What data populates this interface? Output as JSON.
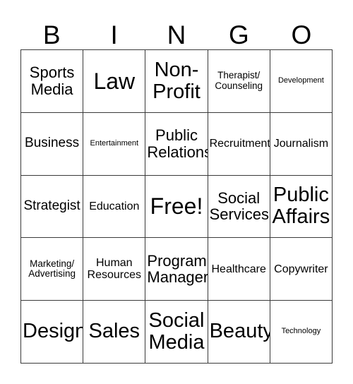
{
  "card": {
    "title": "BINGO",
    "header_letters": [
      "B",
      "I",
      "N",
      "G",
      "O"
    ],
    "free_space_label": "Free!",
    "colors": {
      "background": "#ffffff",
      "border": "#3a3a3a",
      "text": "#000000"
    },
    "grid": {
      "columns": 5,
      "rows": 5
    },
    "cells": [
      {
        "text": "Sports\nMedia",
        "size": "l",
        "free": false
      },
      {
        "text": "Law",
        "size": "huge",
        "free": false
      },
      {
        "text": "Non-\nProfit",
        "size": "xxl",
        "free": false
      },
      {
        "text": "Therapist/\nCounseling",
        "size": "xs",
        "free": false
      },
      {
        "text": "Development",
        "size": "xxs",
        "free": false
      },
      {
        "text": "Business",
        "size": "m",
        "free": false
      },
      {
        "text": "Entertainment",
        "size": "xxs",
        "free": false
      },
      {
        "text": "Public\nRelations",
        "size": "l",
        "free": false
      },
      {
        "text": "Recruitment",
        "size": "s",
        "free": false
      },
      {
        "text": "Journalism",
        "size": "s",
        "free": false
      },
      {
        "text": "Strategist",
        "size": "m",
        "free": false
      },
      {
        "text": "Education",
        "size": "s",
        "free": false
      },
      {
        "text": "Free!",
        "size": "huge",
        "free": true
      },
      {
        "text": "Social\nServices",
        "size": "l",
        "free": false
      },
      {
        "text": "Public\nAffairs",
        "size": "xxl",
        "free": false
      },
      {
        "text": "Marketing/\nAdvertising",
        "size": "xs",
        "free": false
      },
      {
        "text": "Human\nResources",
        "size": "s",
        "free": false
      },
      {
        "text": "Program\nManager",
        "size": "l",
        "free": false
      },
      {
        "text": "Healthcare",
        "size": "s",
        "free": false
      },
      {
        "text": "Copywriter",
        "size": "s",
        "free": false
      },
      {
        "text": "Design",
        "size": "xxl",
        "free": false
      },
      {
        "text": "Sales",
        "size": "xxl",
        "free": false
      },
      {
        "text": "Social\nMedia",
        "size": "xxl",
        "free": false
      },
      {
        "text": "Beauty",
        "size": "xxl",
        "free": false
      },
      {
        "text": "Technology",
        "size": "xxs",
        "free": false
      }
    ]
  }
}
